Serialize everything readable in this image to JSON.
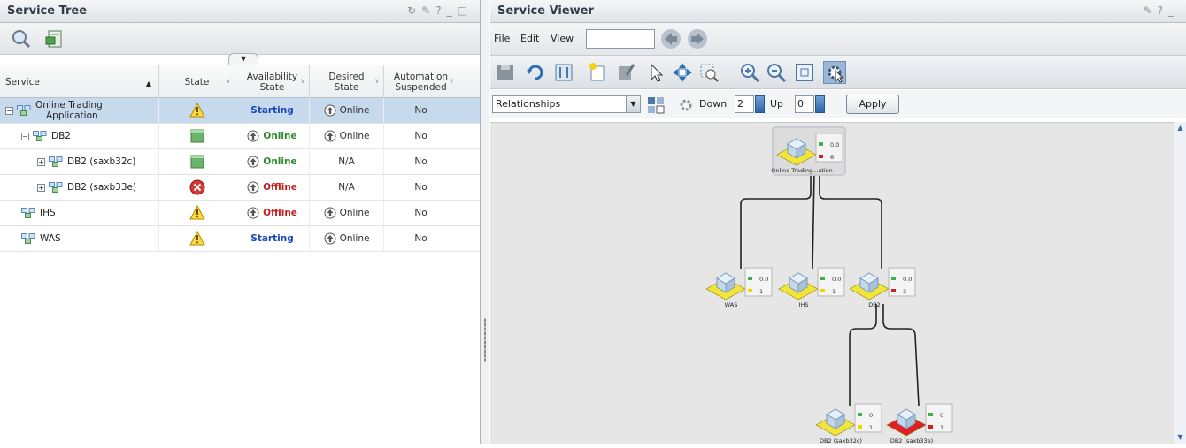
{
  "service_tree": {
    "title": "Service Tree",
    "columns": {
      "service": "Service",
      "state": "State",
      "availability": "Availability State",
      "desired": "Desired State",
      "automation": "Automation Suspended"
    },
    "rows": [
      {
        "name": "Online Trading Application",
        "name_line1": "Online Trading",
        "name_line2": "Application",
        "state": "warning",
        "availability": "Starting",
        "desired": "Online",
        "automation": "No",
        "selected": true,
        "expander": "−",
        "indent": 0
      },
      {
        "name": "DB2",
        "state": "ok",
        "availability": "Online",
        "desired": "Online",
        "automation": "No",
        "selected": false,
        "expander": "−",
        "indent": 1
      },
      {
        "name": "DB2 (saxb32c)",
        "state": "ok",
        "availability": "Online",
        "desired": "N/A",
        "automation": "No",
        "selected": false,
        "expander": "+",
        "indent": 2
      },
      {
        "name": "DB2 (saxb33e)",
        "state": "error",
        "availability": "Offline",
        "desired": "N/A",
        "automation": "No",
        "selected": false,
        "expander": "+",
        "indent": 2
      },
      {
        "name": "IHS",
        "state": "warning",
        "availability": "Offline",
        "desired": "Online",
        "automation": "No",
        "selected": false,
        "expander": "",
        "indent": 1
      },
      {
        "name": "WAS",
        "state": "warning",
        "availability": "Starting",
        "desired": "Online",
        "automation": "No",
        "selected": false,
        "expander": "",
        "indent": 1
      }
    ]
  },
  "service_viewer": {
    "title": "Service Viewer",
    "menu": {
      "file": "File",
      "edit": "Edit",
      "view": "View"
    },
    "relationships": "Relationships",
    "down_label": "Down",
    "down_value": "2",
    "up_label": "Up",
    "up_value": "0",
    "apply": "Apply",
    "nodes": {
      "root": {
        "label": "Online Trading...ation",
        "v1": "0.0",
        "v2": "6"
      },
      "was": {
        "label": "WAS",
        "v1": "0.0",
        "v2": "1"
      },
      "ihs": {
        "label": "IHS",
        "v1": "0.0",
        "v2": "1"
      },
      "db2": {
        "label": "DB2",
        "v1": "0.0",
        "v2": "3"
      },
      "db2a": {
        "label": "DB2 (saxb32c)",
        "v1": "0",
        "v2": "1"
      },
      "db2b": {
        "label": "DB2 (saxb33e)",
        "v1": "0",
        "v2": "1"
      }
    }
  },
  "colors": {
    "selected_row": "#c7d9ed",
    "starting": "#1a47b8",
    "online": "#2d8a2d",
    "offline": "#c21f1f",
    "node_ok": "#f2e53a",
    "node_err": "#e02020"
  }
}
